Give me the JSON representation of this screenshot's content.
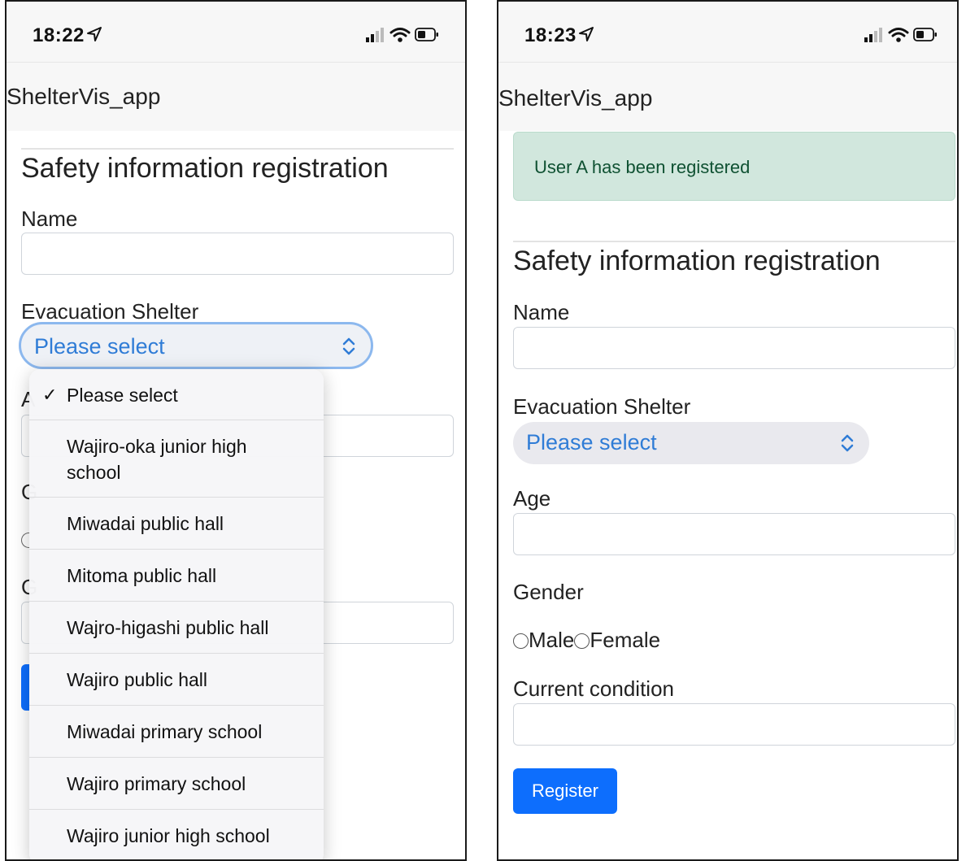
{
  "left_phone": {
    "status_time": "18:22",
    "app_title": "ShelterVis_app",
    "form_title": "Safety information registration",
    "name_label": "Name",
    "shelter_label": "Evacuation Shelter",
    "select_value": "Please select",
    "peek_letters": [
      "A",
      "G",
      "G"
    ],
    "dropdown_options": [
      {
        "label": "Please select",
        "checked": true
      },
      {
        "label": "Wajiro-oka junior high school",
        "checked": false
      },
      {
        "label": "Miwadai public hall",
        "checked": false
      },
      {
        "label": "Mitoma public hall",
        "checked": false
      },
      {
        "label": "Wajro-higashi public hall",
        "checked": false
      },
      {
        "label": "Wajiro public hall",
        "checked": false
      },
      {
        "label": "Miwadai primary school",
        "checked": false
      },
      {
        "label": "Wajiro primary school",
        "checked": false
      },
      {
        "label": "Wajiro junior high school",
        "checked": false
      }
    ],
    "check_mark": "✓"
  },
  "right_phone": {
    "status_time": "18:23",
    "app_title": "ShelterVis_app",
    "alert_text": "User A has been registered",
    "form_title": "Safety information registration",
    "name_label": "Name",
    "shelter_label": "Evacuation Shelter",
    "select_value": "Please select",
    "age_label": "Age",
    "gender_label": "Gender",
    "gender_options": [
      "Male",
      "Female"
    ],
    "condition_label": "Current condition",
    "register_button": "Register"
  },
  "colors": {
    "primary": "#0d6efd",
    "success_bg": "#d1e7dd",
    "success_text": "#0f5132",
    "select_text": "#2f7cd6"
  },
  "icons": [
    "location-arrow-icon",
    "cellular-signal-icon",
    "wifi-icon",
    "battery-icon",
    "chevron-updown-icon",
    "checkmark-icon"
  ]
}
